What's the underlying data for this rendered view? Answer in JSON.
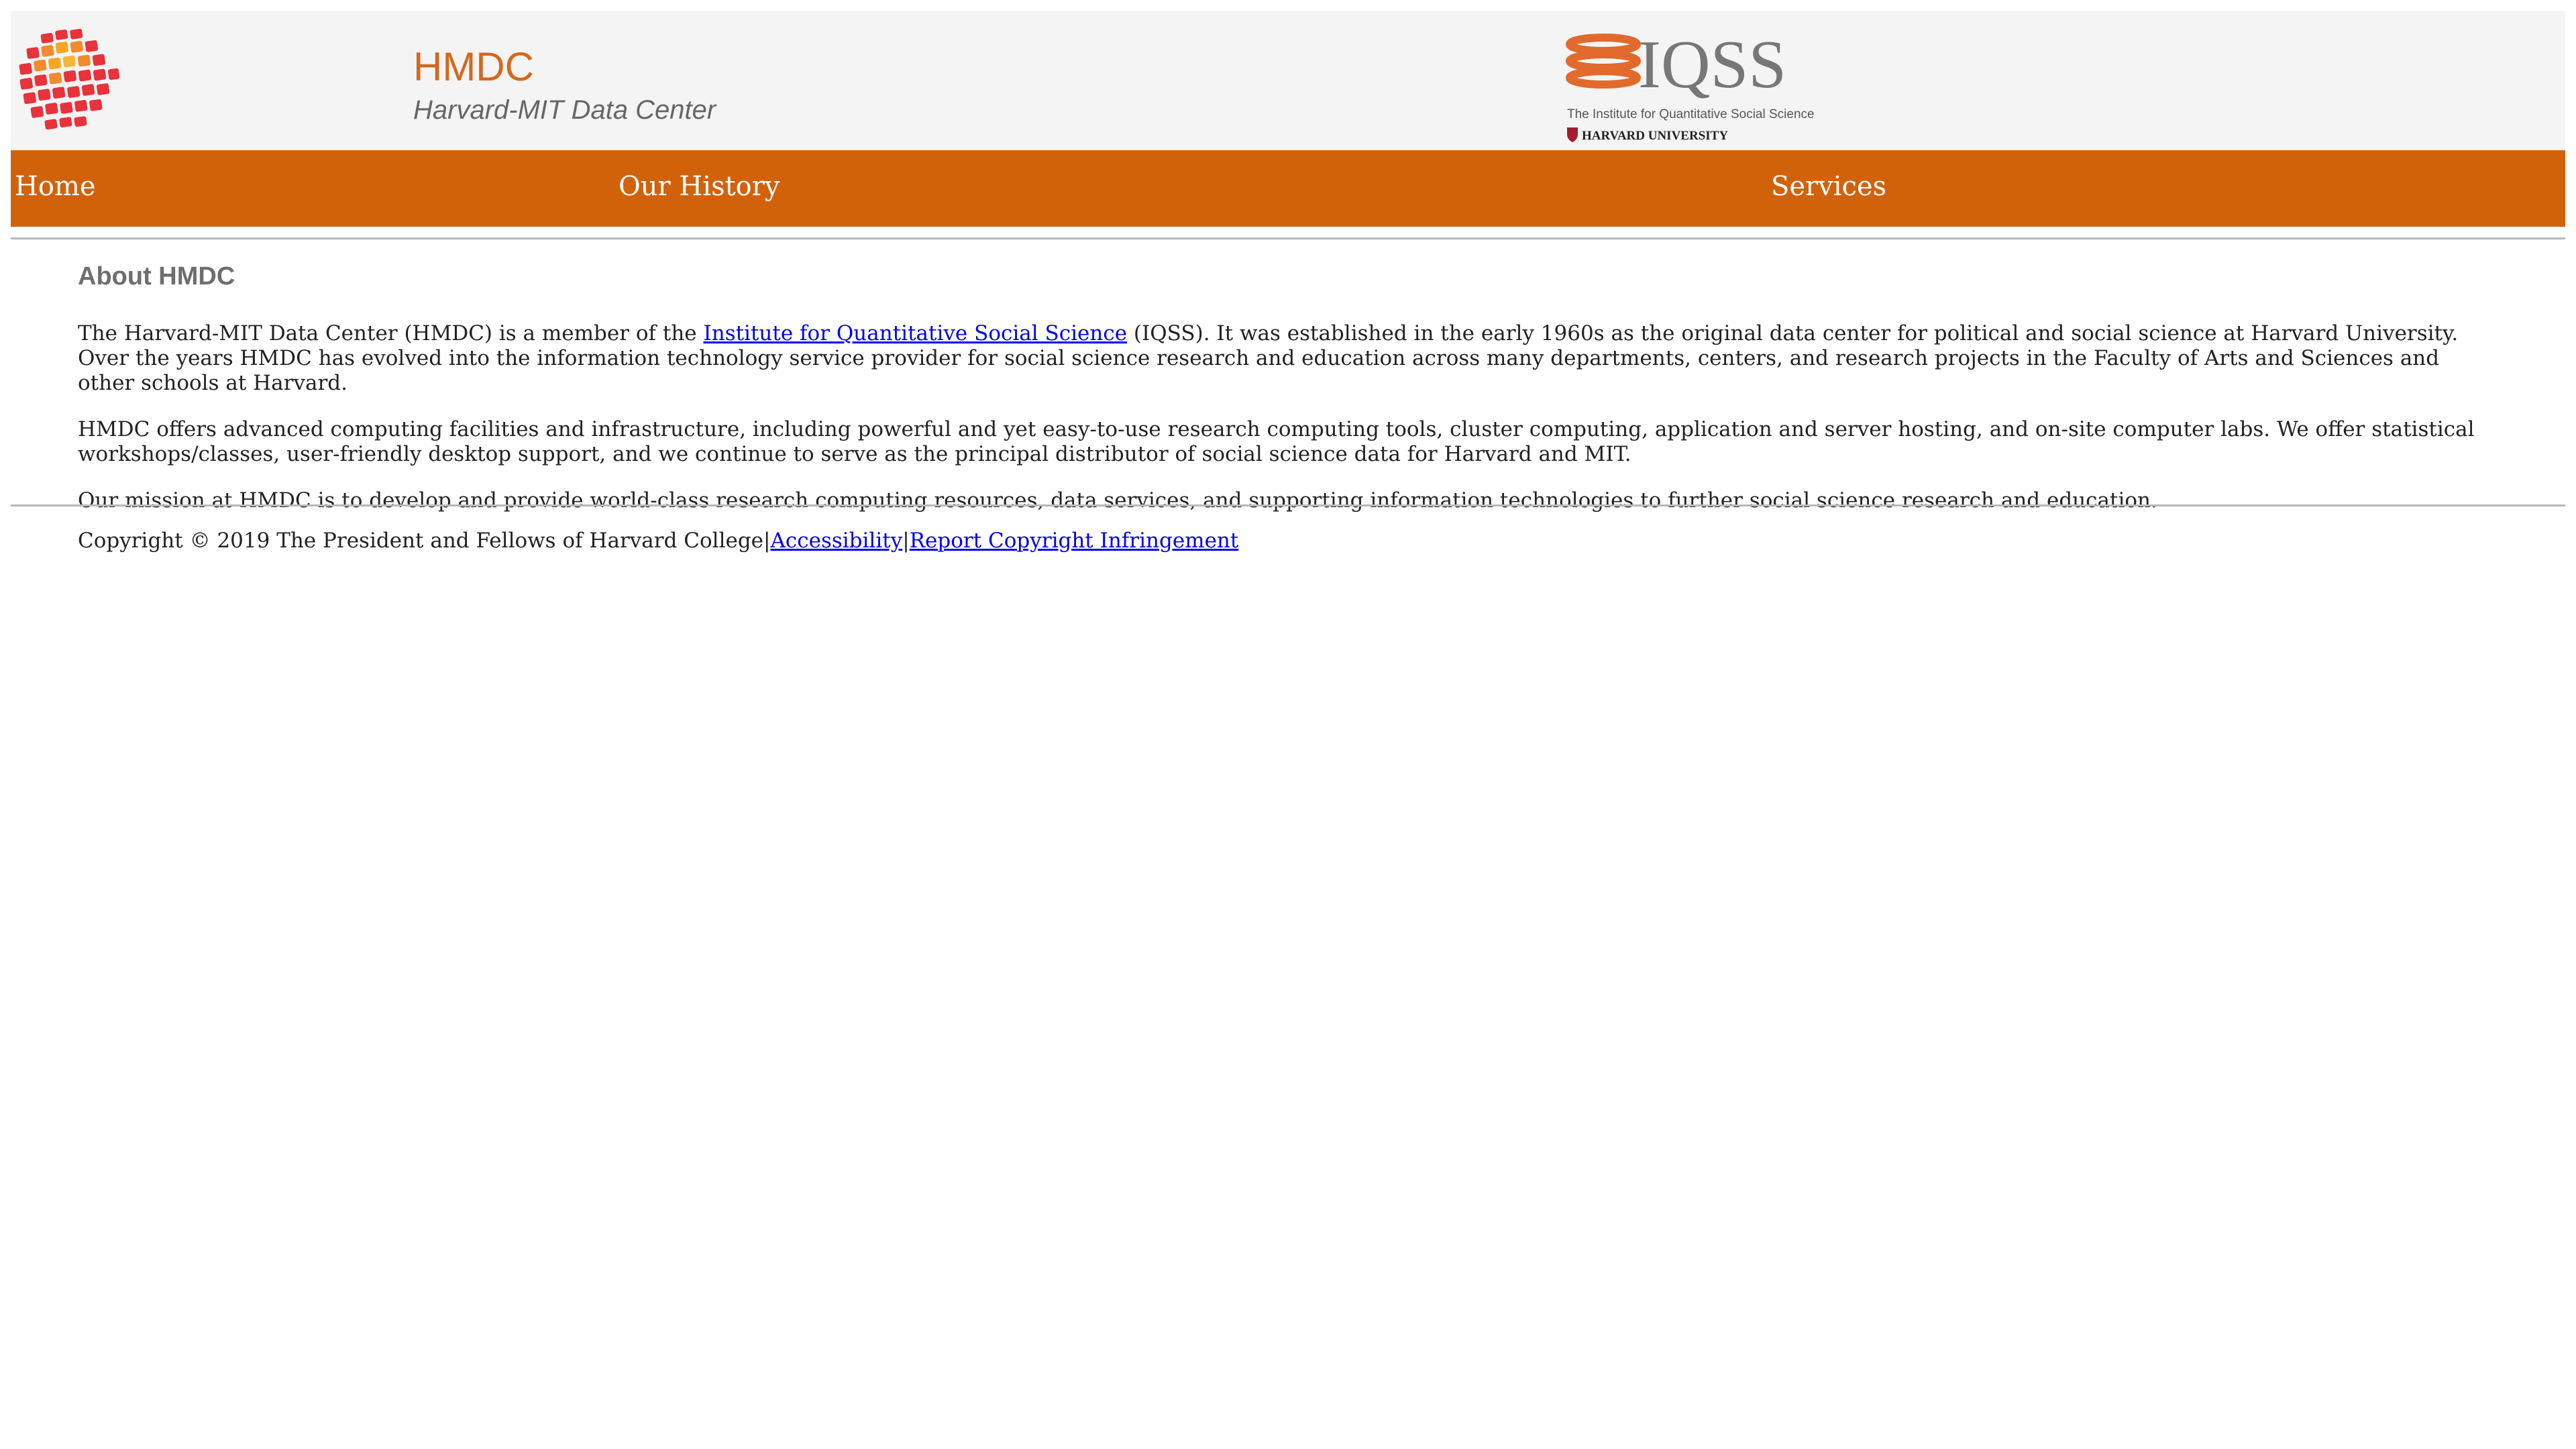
{
  "header": {
    "title": "HMDC",
    "subtitle": "Harvard-MIT Data Center",
    "logo_icon": "hmdc-grid-logo",
    "iqss_logo": {
      "wordmark": "IQSS",
      "tagline": "The Institute for Quantitative Social Science",
      "university": "HARVARD UNIVERSITY"
    }
  },
  "nav": {
    "items": [
      {
        "label": "Home"
      },
      {
        "label": "Our History"
      },
      {
        "label": "Services"
      }
    ]
  },
  "main": {
    "heading": "About HMDC",
    "p1": {
      "before": "The Harvard-MIT Data Center (HMDC) is a member of the ",
      "link": "Institute for Quantitative Social Science",
      "after": " (IQSS). It was established in the early 1960s as the original data center for political and social science at Harvard University. Over the years HMDC has evolved into the information technology service provider for social science research and education across many departments, centers, and research projects in the Faculty of Arts and Sciences and other schools at Harvard."
    },
    "p2": "HMDC offers advanced computing facilities and infrastructure, including powerful and yet easy-to-use research computing tools, cluster computing, application and server hosting, and on-site computer labs. We offer statistical workshops/classes, user-friendly desktop support, and we continue to serve as the principal distributor of social science data for Harvard and MIT.",
    "p3": "Our mission at HMDC is to develop and provide world-class research computing resources, data services, and supporting information technologies to further social science research and education."
  },
  "footer": {
    "copyright": "Copyright © 2019 The President and Fellows of Harvard College",
    "separator": "|",
    "accessibility": "Accessibility",
    "report": "Report Copyright Infringement"
  },
  "colors": {
    "accent": "#d2620a",
    "title": "#d2691e",
    "link": "#0000ee"
  }
}
